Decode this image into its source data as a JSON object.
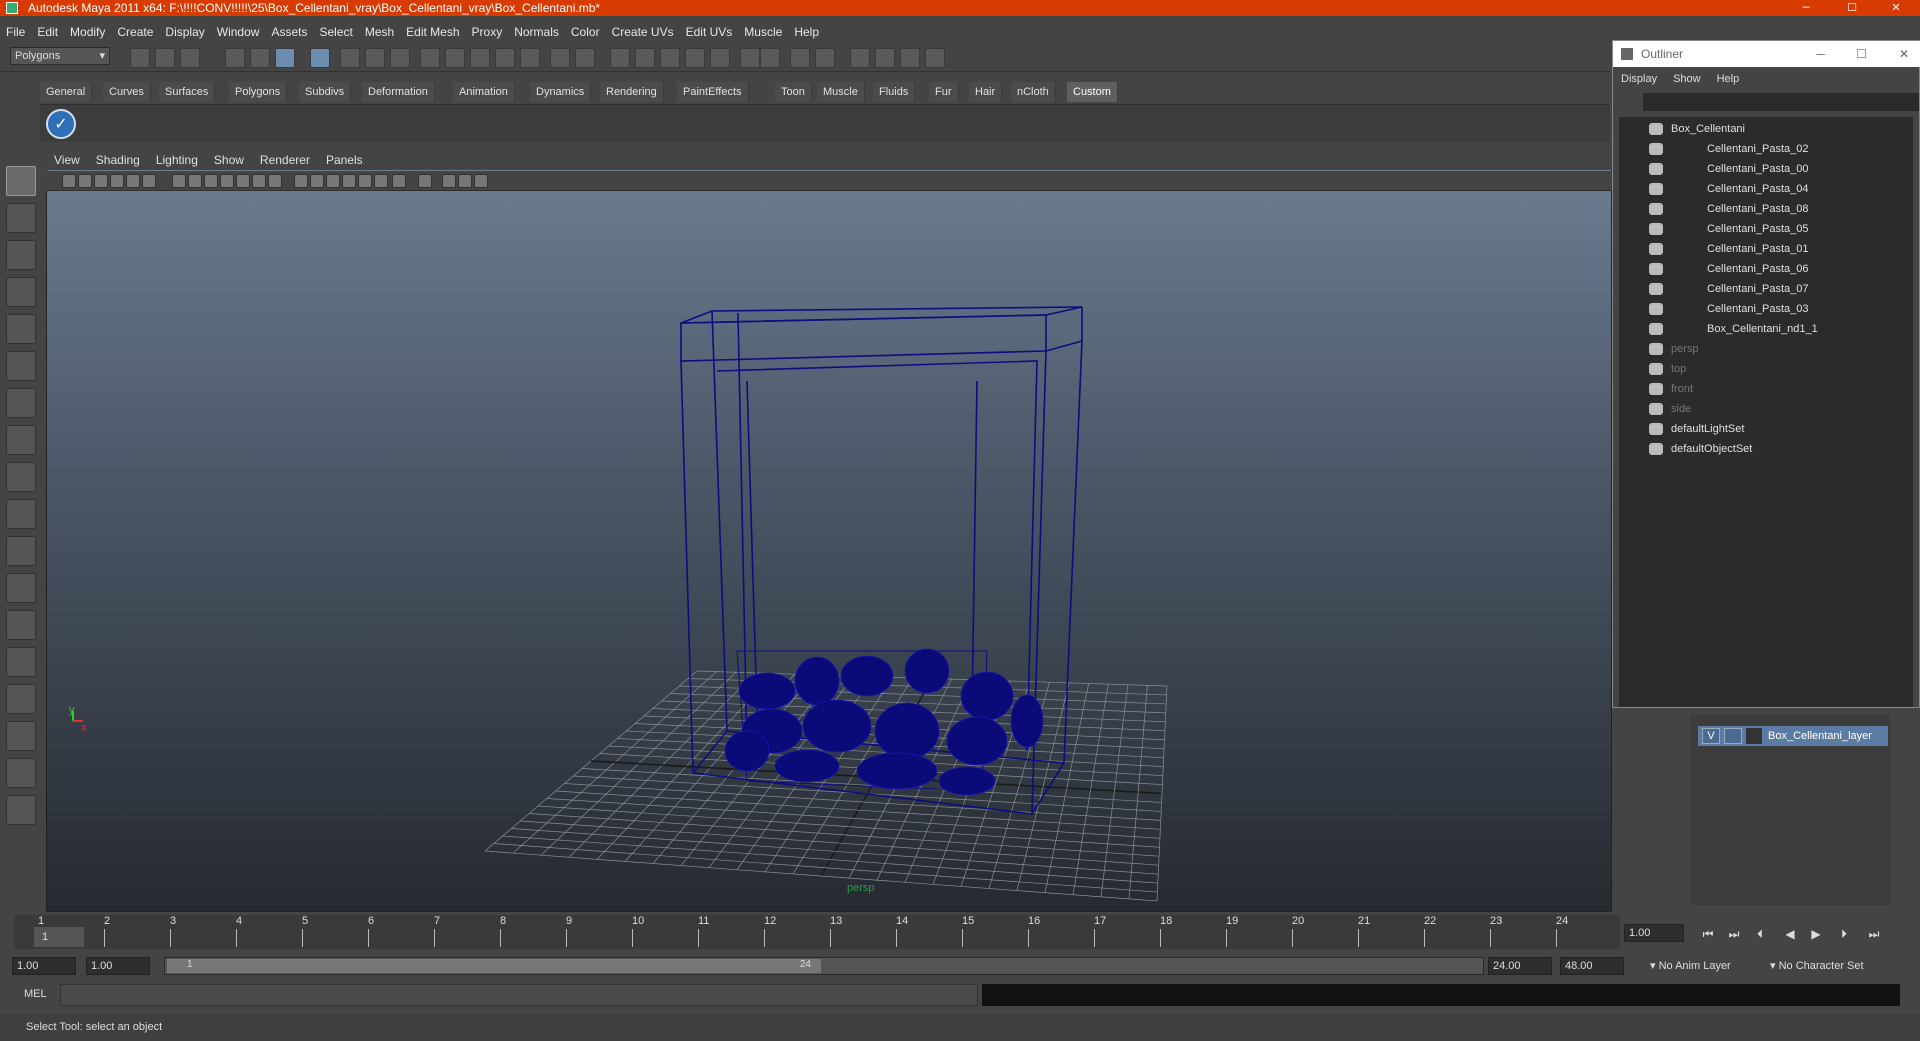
{
  "window": {
    "title": "Autodesk Maya 2011 x64: F:\\!!!!CONV!!!!!\\25\\Box_Cellentani_vray\\Box_Cellentani_vray\\Box_Cellentani.mb*",
    "min_glyph": "─",
    "max_glyph": "☐",
    "close_glyph": "✕"
  },
  "menubar": [
    "File",
    "Edit",
    "Modify",
    "Create",
    "Display",
    "Window",
    "Assets",
    "Select",
    "Mesh",
    "Edit Mesh",
    "Proxy",
    "Normals",
    "Color",
    "Create UVs",
    "Edit UVs",
    "Muscle",
    "Help"
  ],
  "status": {
    "mode": "Polygons"
  },
  "shelf": {
    "tabs": [
      "General",
      "Curves",
      "Surfaces",
      "Polygons",
      "Subdivs",
      "Deformation",
      "Animation",
      "Dynamics",
      "Rendering",
      "PaintEffects",
      "Toon",
      "Muscle",
      "Fluids",
      "Fur",
      "Hair",
      "nCloth",
      "Custom"
    ],
    "active": "Custom"
  },
  "viewport": {
    "menu": [
      "View",
      "Shading",
      "Lighting",
      "Show",
      "Renderer",
      "Panels"
    ],
    "axis_x": "x",
    "axis_y": "y",
    "camera_label": "persp"
  },
  "outliner": {
    "title": "Outliner",
    "menu": [
      "Display",
      "Show",
      "Help"
    ],
    "items": [
      {
        "label": "Box_Cellentani",
        "level": 0,
        "dim": false
      },
      {
        "label": "Cellentani_Pasta_02",
        "level": 1,
        "dim": false
      },
      {
        "label": "Cellentani_Pasta_00",
        "level": 1,
        "dim": false
      },
      {
        "label": "Cellentani_Pasta_04",
        "level": 1,
        "dim": false
      },
      {
        "label": "Cellentani_Pasta_08",
        "level": 1,
        "dim": false
      },
      {
        "label": "Cellentani_Pasta_05",
        "level": 1,
        "dim": false
      },
      {
        "label": "Cellentani_Pasta_01",
        "level": 1,
        "dim": false
      },
      {
        "label": "Cellentani_Pasta_06",
        "level": 1,
        "dim": false
      },
      {
        "label": "Cellentani_Pasta_07",
        "level": 1,
        "dim": false
      },
      {
        "label": "Cellentani_Pasta_03",
        "level": 1,
        "dim": false
      },
      {
        "label": "Box_Cellentani_nd1_1",
        "level": 1,
        "dim": false
      },
      {
        "label": "persp",
        "level": 0,
        "dim": true
      },
      {
        "label": "top",
        "level": 0,
        "dim": true
      },
      {
        "label": "front",
        "level": 0,
        "dim": true
      },
      {
        "label": "side",
        "level": 0,
        "dim": true
      },
      {
        "label": "defaultLightSet",
        "level": 0,
        "dim": false
      },
      {
        "label": "defaultObjectSet",
        "level": 0,
        "dim": false
      }
    ]
  },
  "layers": {
    "visible_flag": "V",
    "layer_name": "Box_Cellentani_layer"
  },
  "timeline": {
    "ticks": [
      "1",
      "2",
      "3",
      "4",
      "5",
      "6",
      "7",
      "8",
      "9",
      "10",
      "11",
      "12",
      "13",
      "14",
      "15",
      "16",
      "17",
      "18",
      "19",
      "20",
      "21",
      "22",
      "23",
      "24"
    ],
    "current_frame": "1",
    "current_time_field": "1.00"
  },
  "range": {
    "start_time": "1.00",
    "start_playback": "1.00",
    "slider_start": "1",
    "slider_end": "24",
    "end_playback": "24.00",
    "end_time": "48.00",
    "anim_layer": "No Anim Layer",
    "character_set": "No Character Set"
  },
  "command": {
    "label": "MEL"
  },
  "help_line": "Select Tool: select an object",
  "colors": {
    "title_bar": "#d83b01",
    "wireframe": "#0d0d80",
    "layer_highlight": "#5c7ba3"
  }
}
